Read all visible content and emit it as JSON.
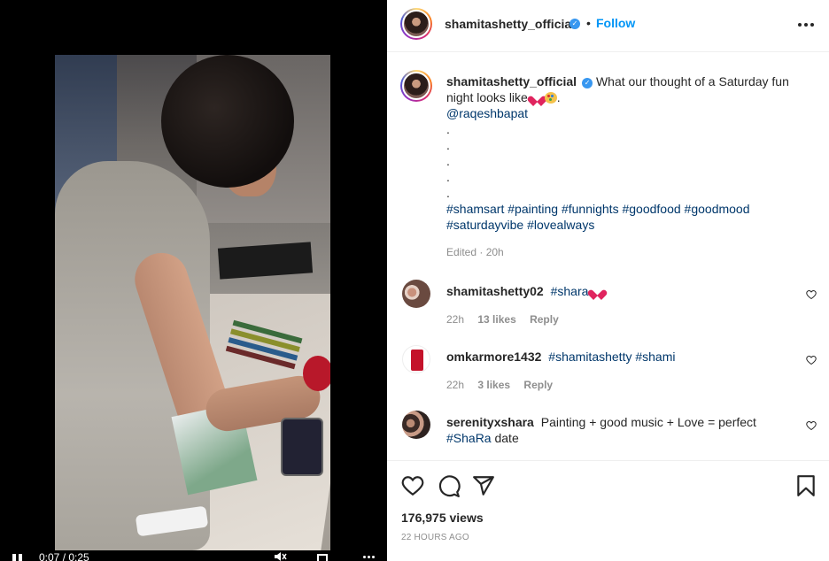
{
  "post": {
    "author": "shamitashetty_official",
    "verified_icon": "verified-badge-icon",
    "separator": "•",
    "follow_label": "Follow",
    "options_icon": "more-horizontal-icon"
  },
  "video": {
    "time_readout": "0:07 / 0:25",
    "icons": [
      "pause-icon",
      "mute-icon",
      "fullscreen-icon",
      "more-icon"
    ]
  },
  "caption": {
    "author": "shamitashetty_official",
    "text": "What our thought of a Saturday fun night looks like",
    "emojis": [
      "red-heart",
      "artist-palette"
    ],
    "text_end": ".",
    "mention": "@raqeshbapat",
    "dots": [
      ".",
      ".",
      ".",
      ".",
      "."
    ],
    "hashtags": [
      "#shamsart",
      "#painting",
      "#funnights",
      "#goodfood",
      "#goodmood",
      "#saturdayvibe",
      "#lovealways"
    ],
    "edited_meta": "Edited · 20h"
  },
  "comments": [
    {
      "username": "shamitashetty02",
      "text": "#shara",
      "has_heart_emoji": true,
      "time": "22h",
      "likes": "13 likes",
      "reply": "Reply"
    },
    {
      "username": "omkarmore1432",
      "text": "#shamitashetty #shami",
      "has_heart_emoji": false,
      "time": "22h",
      "likes": "3 likes",
      "reply": "Reply"
    },
    {
      "username": "serenityxshara",
      "text": "Painting + good music + Love = perfect",
      "text_tag": "#ShaRa",
      "text_after": "date",
      "has_heart_emoji": false
    }
  ],
  "actions": {
    "icons": [
      "heart-icon",
      "comment-icon",
      "share-icon",
      "save-icon"
    ],
    "views": "176,975 views",
    "timestamp": "22 HOURS AGO"
  },
  "colors": {
    "link": "#00376b",
    "follow": "#0095f6",
    "meta": "#8e8e8e",
    "heart": "#e0245e",
    "verified": "#3897f0"
  }
}
